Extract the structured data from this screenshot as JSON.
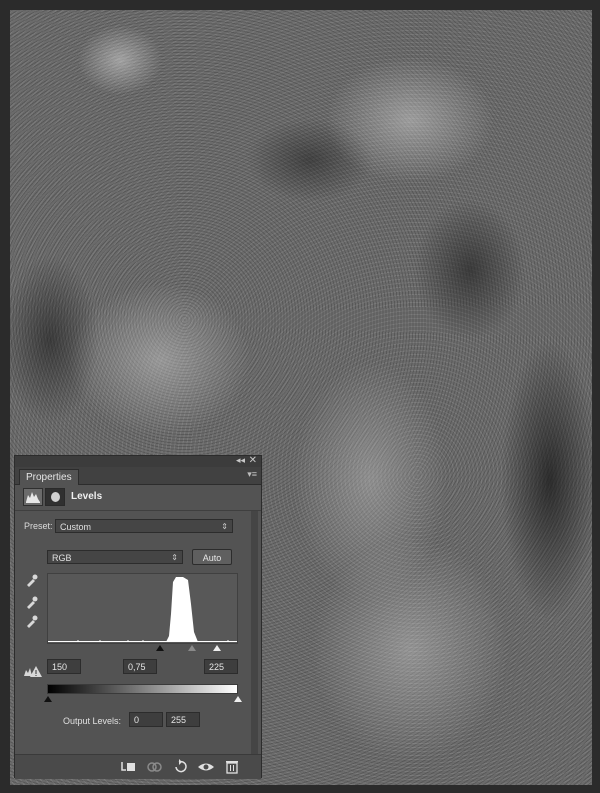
{
  "canvas": {
    "description_icon": "grunge-texture-image"
  },
  "panel": {
    "tab_label": "Properties",
    "title": "Levels",
    "preset": {
      "label": "Preset:",
      "value": "Custom"
    },
    "channel": {
      "value": "RGB"
    },
    "auto_label": "Auto",
    "input_levels": {
      "black": "150",
      "gamma": "0,75",
      "white": "225"
    },
    "output_levels": {
      "label": "Output Levels:",
      "black": "0",
      "white": "255"
    }
  },
  "icons": {
    "eyedroppers": [
      "black-point-eyedropper-icon",
      "gray-point-eyedropper-icon",
      "white-point-eyedropper-icon"
    ],
    "footer": [
      "clip-to-layer-icon",
      "view-previous-state-icon",
      "reset-icon",
      "visibility-icon",
      "delete-icon"
    ]
  }
}
